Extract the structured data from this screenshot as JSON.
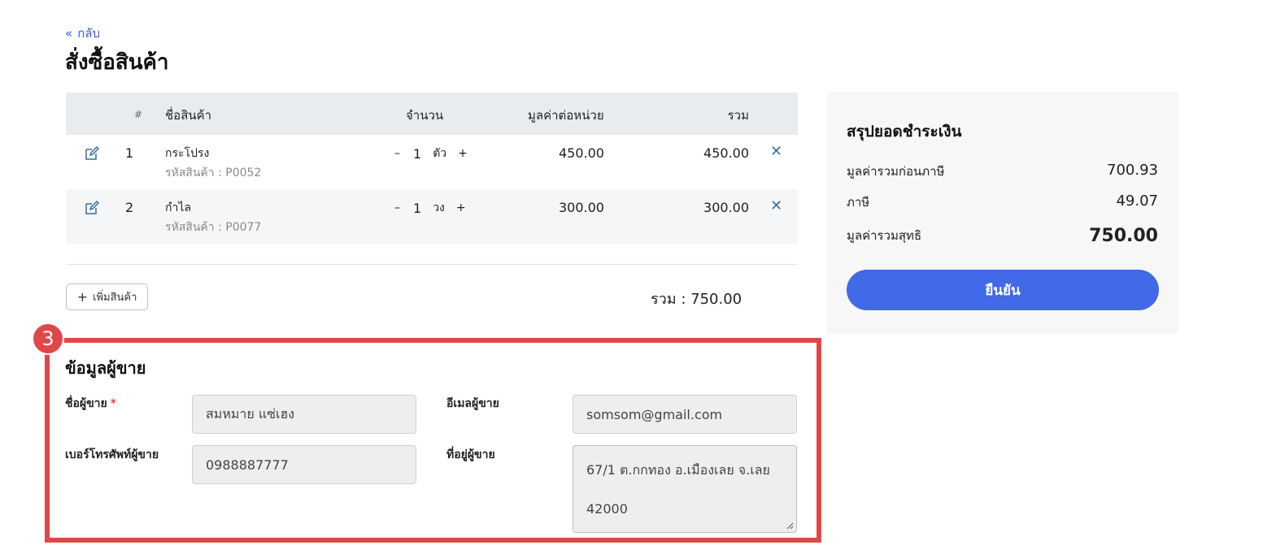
{
  "header": {
    "back_label": "กลับ",
    "title": "สั่งซื้อสินค้า"
  },
  "table": {
    "columns": {
      "num": "#",
      "name": "ชื่อสินค้า",
      "qty": "จำนวน",
      "price": "มูลค่าต่อหน่วย",
      "total": "รวม"
    },
    "rows": [
      {
        "index": "1",
        "name": "กระโปรง",
        "code": "รหัสสินค้า : P0052",
        "qty": "1",
        "unit": "ตัว",
        "price": "450.00",
        "total": "450.00"
      },
      {
        "index": "2",
        "name": "กำไล",
        "code": "รหัสสินค้า : P0077",
        "qty": "1",
        "unit": "วง",
        "price": "300.00",
        "total": "300.00"
      }
    ],
    "minus_label": "–",
    "plus_label": "+",
    "delete_label": "✕"
  },
  "add_product_label": "เพิ่มสินค้า",
  "subtotal_line": "รวม : 750.00",
  "summary": {
    "title": "สรุปยอดชำระเงิน",
    "before_tax_label": "มูลค่ารวมก่อนภาษี",
    "before_tax_value": "700.93",
    "tax_label": "ภาษี",
    "tax_value": "49.07",
    "net_label": "มูลค่ารวมสุทธิ",
    "net_value": "750.00",
    "confirm_label": "ยืนยัน"
  },
  "step_badge": "3",
  "seller": {
    "title": "ข้อมูลผู้ขาย",
    "name_label": "ชื่อผู้ขาย",
    "required_mark": "*",
    "name_value": "สมหมาย แซ่เฮง",
    "email_label": "อีเมลผู้ขาย",
    "email_value": "somsom@gmail.com",
    "phone_label": "เบอร์โทรศัพท์ผู้ขาย",
    "phone_value": "0988887777",
    "address_label": "ที่อยู่ผู้ขาย",
    "address_line1": "67/1 ต.กกทอง อ.เมืองเลย จ.เลย",
    "address_line2": "42000"
  },
  "colors": {
    "accent": "#4169e8",
    "highlight": "#e04848",
    "link": "#3b5bdb"
  }
}
